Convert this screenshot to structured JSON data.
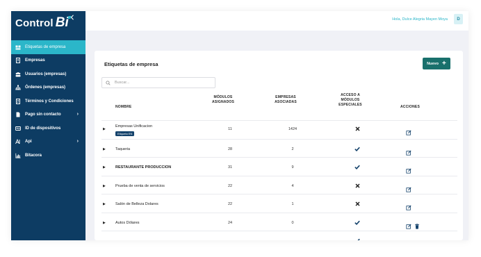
{
  "brand": {
    "name": "Control",
    "mark": "Bi"
  },
  "colors": {
    "sidebar": "#0d3c63",
    "accent": "#2bb6c9",
    "primary_button": "#19706c",
    "badge": "#14426b"
  },
  "sidebar": {
    "collapse_icon": "chevron-left-icon",
    "items": [
      {
        "label": "Etiquetas de empresa",
        "icon": "tags-icon",
        "active": true
      },
      {
        "label": "Empresas",
        "icon": "building-icon"
      },
      {
        "label": "Usuarios (empresas)",
        "icon": "users-icon"
      },
      {
        "label": "Órdenes (empresas)",
        "icon": "sitemap-icon"
      },
      {
        "label": "Términos y Condiciones",
        "icon": "document-icon"
      },
      {
        "label": "Pago sin contacto",
        "icon": "file-icon",
        "has_submenu": true
      },
      {
        "label": "ID de dispositivos",
        "icon": "id-card-icon"
      },
      {
        "label": "Api",
        "icon": "api-icon",
        "has_submenu": true
      },
      {
        "label": "Bitacora",
        "icon": "chart-icon"
      }
    ]
  },
  "topbar": {
    "greeting": "Hola, Dulce Alegria Mayen Moya",
    "avatar_initial": "D"
  },
  "page": {
    "title": "Etiquetas de empresa",
    "new_button": "Nuevo",
    "search_placeholder": "Buscar..."
  },
  "table": {
    "headers": {
      "name": "NOMBRE",
      "modules": [
        "MÓDULOS",
        "ASIGNADOS"
      ],
      "companies": [
        "EMPRESAS",
        "ASOCIADAS"
      ],
      "access": [
        "ACCESO A",
        "MÓDULOS",
        "ESPECIALES"
      ],
      "actions": "ACCIONES"
    },
    "rows": [
      {
        "name": "Empresas Unificacion",
        "badge": "Etiqueta EN",
        "modules": "11",
        "companies": "1424",
        "access": false,
        "delete": false,
        "bold": false
      },
      {
        "name": "Taqueria",
        "modules": "28",
        "companies": "2",
        "access": true,
        "delete": false,
        "bold": false
      },
      {
        "name": "RESTAURANTE PRODUCCION",
        "modules": "31",
        "companies": "9",
        "access": true,
        "delete": false,
        "bold": true
      },
      {
        "name": "Prueba de venta de servicios",
        "modules": "22",
        "companies": "4",
        "access": false,
        "delete": false,
        "bold": false
      },
      {
        "name": "Salón de Belleza Dolares",
        "modules": "22",
        "companies": "1",
        "access": false,
        "delete": false,
        "bold": false
      },
      {
        "name": "Autos Dólares",
        "modules": "24",
        "companies": "0",
        "access": true,
        "delete": true,
        "bold": false
      },
      {
        "name": "",
        "modules": "",
        "companies": "",
        "access": true,
        "delete": true,
        "bold": false
      }
    ]
  }
}
